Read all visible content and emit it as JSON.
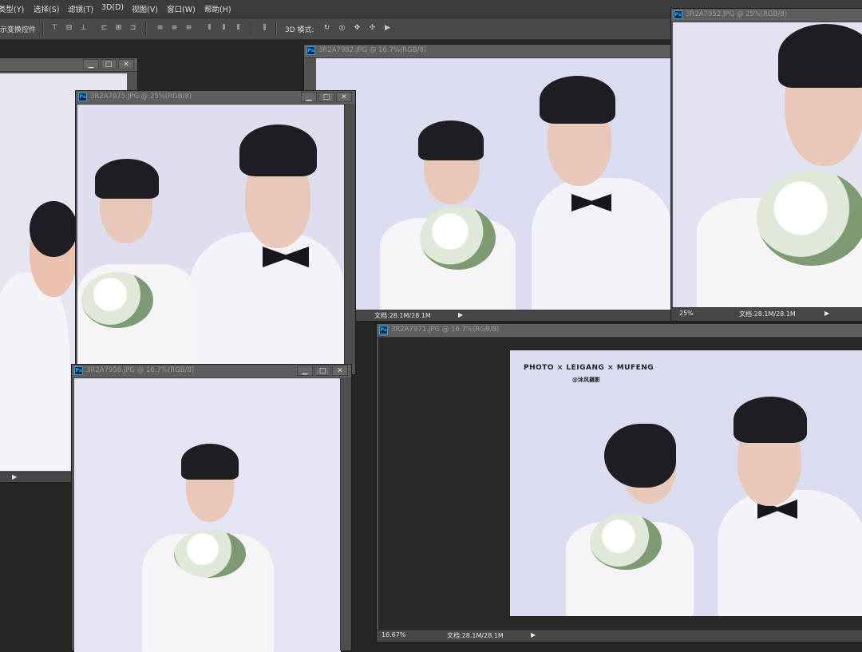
{
  "menu": [
    "类型(Y)",
    "选择(S)",
    "滤镜(T)",
    "3D(D)",
    "视图(V)",
    "窗口(W)",
    "帮助(H)"
  ],
  "options": {
    "transform_label": "示变换控件",
    "mode_3d_label": "3D 模式:"
  },
  "windows": {
    "left": {},
    "w7975": {
      "title": "3R2A7975.JPG @ 25%(RGB/8)"
    },
    "w7982": {
      "title": "3R2A7982.JPG @ 16.7%(RGB/8)",
      "doc": "文档:28.1M/28.1M"
    },
    "w7952": {
      "title": "3R2A7952.JPG @ 25%(RGB/8)",
      "zoom": "25%",
      "doc": "文档:28.1M/28.1M"
    },
    "w7956": {
      "title": "3R2A7956.JPG @ 16.7%(RGB/8)"
    },
    "w7971": {
      "title": "3R2A7971.JPG @ 16.7%(RGB/8)",
      "zoom": "16.67%",
      "doc": "文档:28.1M/28.1M",
      "watermark_line1": "PHOTO × LEIGANG × MUFENG",
      "watermark_line2": "@沐风摄影"
    }
  },
  "window_buttons": {
    "minimize": "▁",
    "maximize": "□",
    "close": "✕"
  },
  "status_arrow": "▶"
}
